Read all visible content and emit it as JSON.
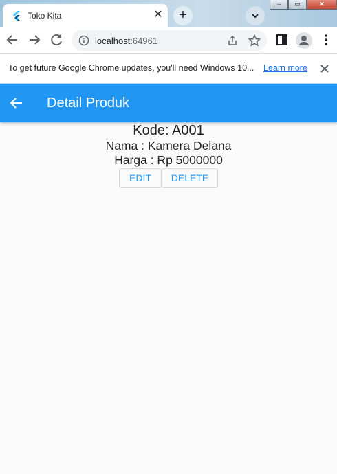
{
  "browser": {
    "tab_title": "Toko Kita",
    "url_host": "localhost",
    "url_port": ":64961",
    "window_controls": [
      "–",
      "▭",
      "✕"
    ]
  },
  "infobar": {
    "message": "To get future Google Chrome updates, you'll need Windows 10...",
    "link": "Learn more"
  },
  "appbar": {
    "title": "Detail Produk",
    "color": "#2196f3"
  },
  "product": {
    "kode": "Kode: A001",
    "nama": "Nama : Kamera Delana",
    "harga": "Harga : Rp 5000000"
  },
  "actions": {
    "edit_label": "EDIT",
    "delete_label": "DELETE"
  }
}
